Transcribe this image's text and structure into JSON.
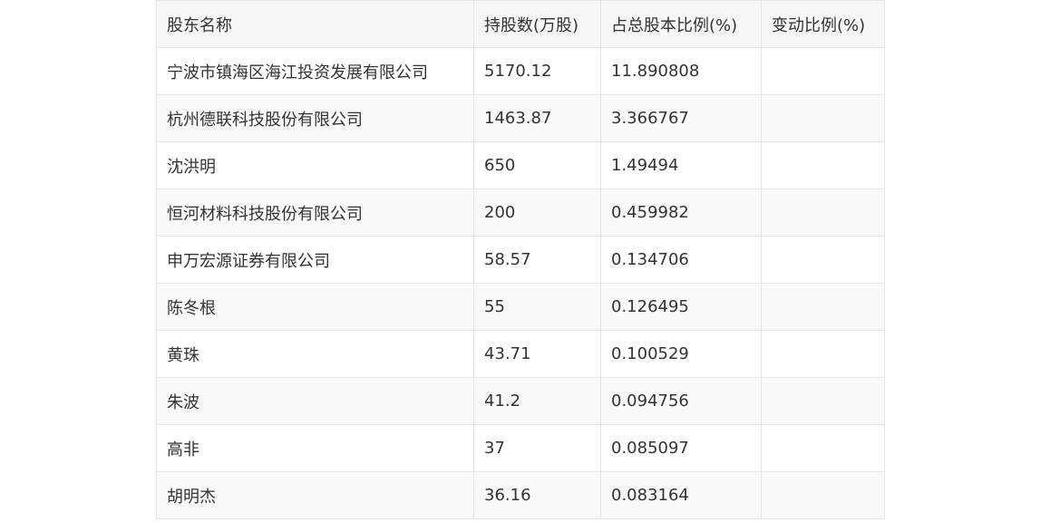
{
  "table": {
    "headers": [
      "股东名称",
      "持股数(万股)",
      "占总股本比例(%)",
      "变动比例(%)"
    ],
    "rows": [
      [
        "宁波市镇海区海江投资发展有限公司",
        "5170.12",
        "11.890808",
        ""
      ],
      [
        "杭州德联科技股份有限公司",
        "1463.87",
        "3.366767",
        ""
      ],
      [
        "沈洪明",
        "650",
        "1.49494",
        ""
      ],
      [
        "恒河材料科技股份有限公司",
        "200",
        "0.459982",
        ""
      ],
      [
        "申万宏源证券有限公司",
        "58.57",
        "0.134706",
        ""
      ],
      [
        "陈冬根",
        "55",
        "0.126495",
        ""
      ],
      [
        "黄珠",
        "43.71",
        "0.100529",
        ""
      ],
      [
        "朱波",
        "41.2",
        "0.094756",
        ""
      ],
      [
        "高非",
        "37",
        "0.085097",
        ""
      ],
      [
        "胡明杰",
        "36.16",
        "0.083164",
        ""
      ]
    ]
  },
  "colors": {
    "header_bg": "#f7f7f7",
    "row_alt_bg": "#f9f9f9",
    "border": "#e6e6e6",
    "text": "#333333"
  }
}
